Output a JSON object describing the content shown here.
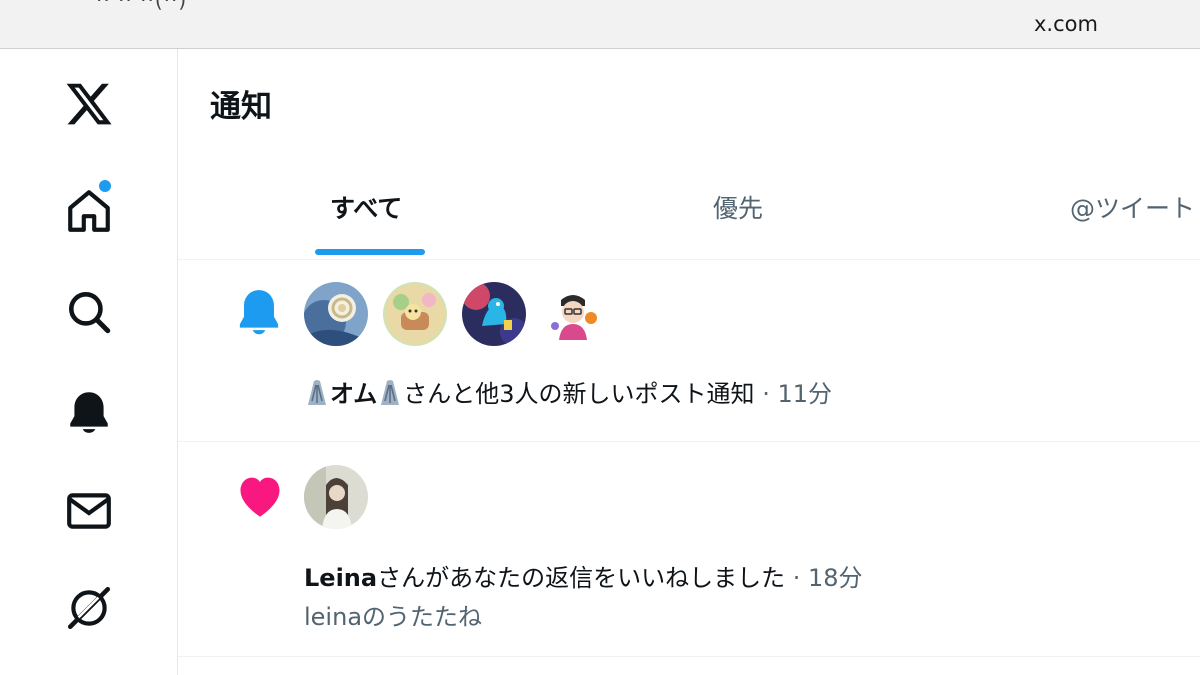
{
  "browser": {
    "top_cut_text": "·· ·· ··(··)",
    "url": "x.com"
  },
  "sidebar": {
    "items": [
      {
        "icon": "x-logo-icon",
        "label": "X"
      },
      {
        "icon": "home-icon",
        "label": "ホーム",
        "has_dot": true
      },
      {
        "icon": "search-icon",
        "label": "検索"
      },
      {
        "icon": "bell-icon",
        "label": "通知"
      },
      {
        "icon": "mail-icon",
        "label": "メッセージ"
      },
      {
        "icon": "grok-icon",
        "label": "Grok"
      }
    ]
  },
  "header": {
    "title": "通知"
  },
  "tabs": [
    {
      "label": "すべて",
      "active": true
    },
    {
      "label": "優先",
      "active": false
    },
    {
      "label": "@ツイート",
      "active": false
    }
  ],
  "notifications": [
    {
      "type": "new-post",
      "icon": "bell-filled-icon",
      "avatar_count": 4,
      "name": "オム",
      "rest": "さんと他3人の新しいポスト通知",
      "sep": " · ",
      "time": "11分"
    },
    {
      "type": "like",
      "icon": "heart-filled-icon",
      "avatar_count": 1,
      "name": "Leina",
      "rest": "さんがあなたの返信をいいねしました",
      "sep": " · ",
      "time": "18分",
      "sub": "leinaのうたたね"
    }
  ],
  "colors": {
    "accent": "#1d9bf0",
    "like": "#f91880",
    "text_primary": "#0f1419",
    "text_secondary": "#536471"
  }
}
